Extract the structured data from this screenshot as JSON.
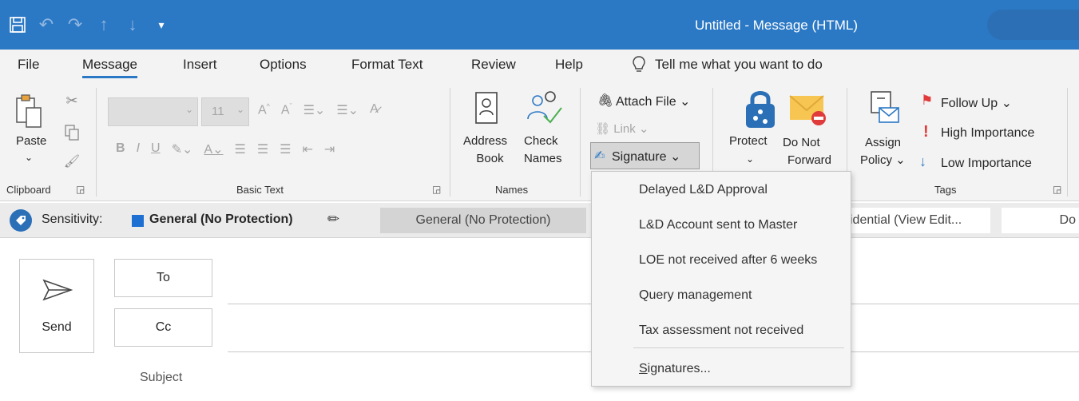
{
  "window": {
    "title": "Untitled  -  Message (HTML)"
  },
  "tabs": [
    {
      "label": "File"
    },
    {
      "label": "Message",
      "active": true
    },
    {
      "label": "Insert"
    },
    {
      "label": "Options"
    },
    {
      "label": "Format Text"
    },
    {
      "label": "Review"
    },
    {
      "label": "Help"
    }
  ],
  "tell_me": "Tell me what you want to do",
  "ribbon": {
    "clipboard": {
      "paste_label": "Paste",
      "group_label": "Clipboard"
    },
    "basic_text": {
      "font_size": "11",
      "group_label": "Basic Text"
    },
    "names": {
      "address_book": [
        "Address",
        "Book"
      ],
      "check_names": [
        "Check",
        "Names"
      ],
      "group_label": "Names"
    },
    "include": {
      "attach_file": "Attach File",
      "link": "Link",
      "signature": "Signature"
    },
    "protect": {
      "protect_label": "Protect",
      "do_not_forward": [
        "Do Not",
        "Forward"
      ]
    },
    "tags": {
      "assign_policy": [
        "Assign",
        "Policy"
      ],
      "follow_up": "Follow Up",
      "high_importance": "High Importance",
      "low_importance": "Low Importance",
      "group_label": "Tags"
    }
  },
  "sensitivity": {
    "label": "Sensitivity:",
    "value": "General (No Protection)",
    "buttons": [
      "General (No Protection)",
      "idential (View Edit...",
      "Do"
    ],
    "accent": "#1d6fd1"
  },
  "compose": {
    "send": "Send",
    "to": "To",
    "cc": "Cc",
    "subject": "Subject"
  },
  "signature_menu": {
    "items": [
      "Delayed L&D Approval",
      "L&D Account sent to Master",
      "LOE not received after 6 weeks",
      "Query management",
      "Tax assessment not received"
    ],
    "manage_prefix": "S",
    "manage_rest": "ignatures..."
  },
  "colors": {
    "titlebar": "#2b78c5",
    "ribbon_bg": "#f3f3f3",
    "follow_up_flag": "#e03a3a",
    "high_importance": "#e03a3a",
    "low_importance": "#2b78c5"
  }
}
